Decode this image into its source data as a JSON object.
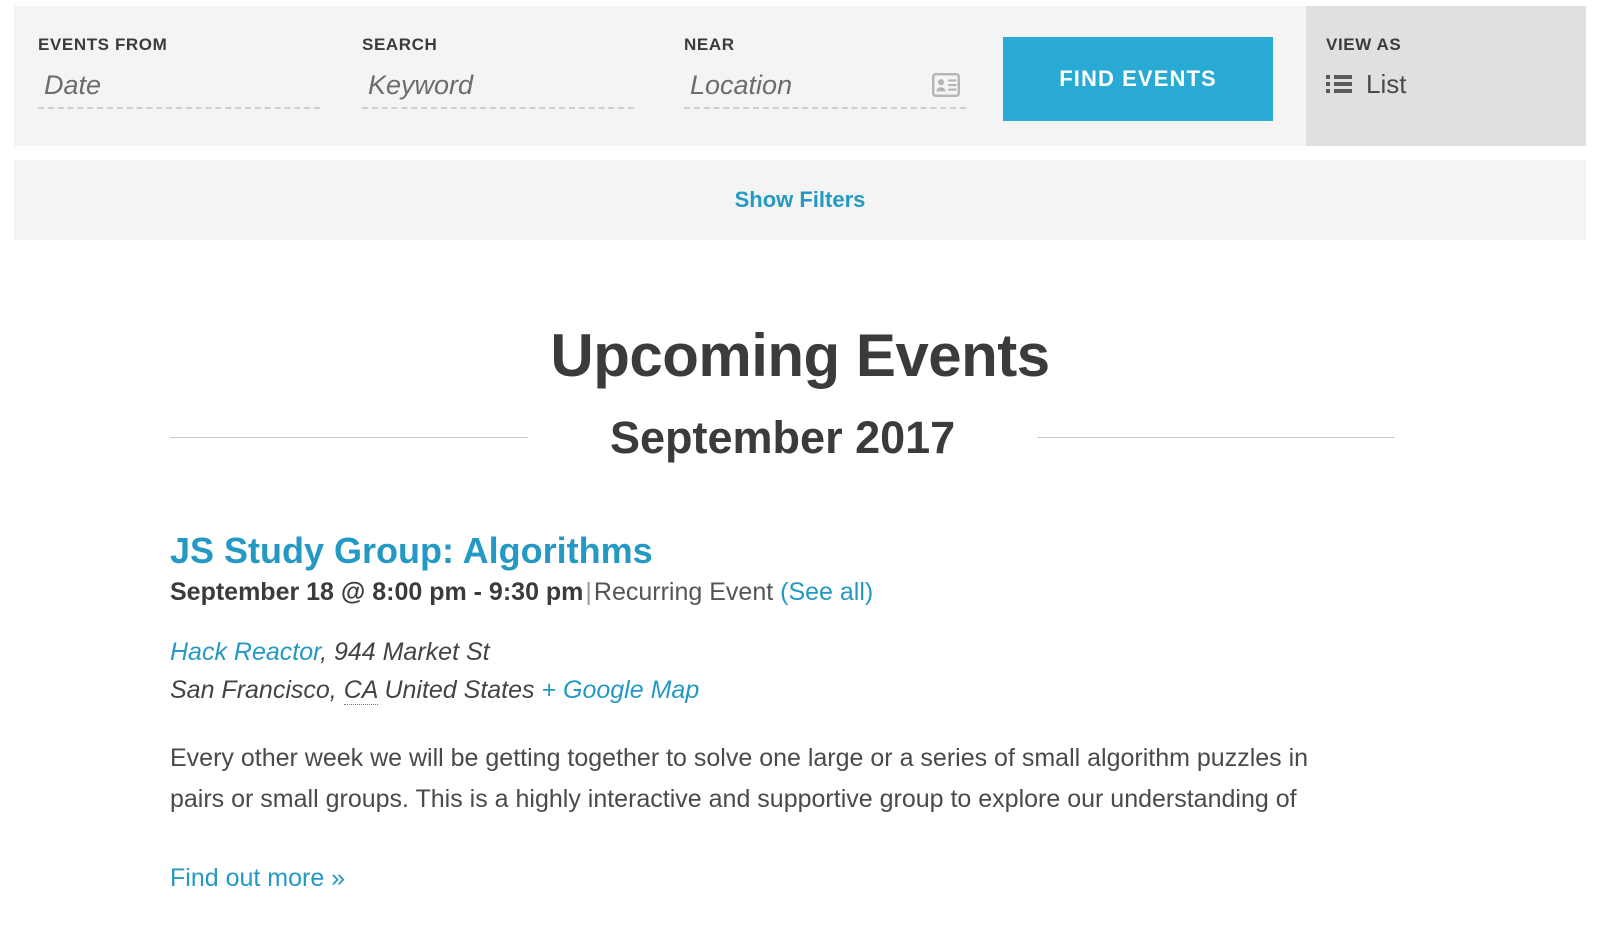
{
  "search_bar": {
    "fields": [
      {
        "label": "EVENTS FROM",
        "placeholder": "Date",
        "value": "",
        "name": "events-from"
      },
      {
        "label": "SEARCH",
        "placeholder": "Keyword",
        "value": "",
        "name": "search-keyword"
      },
      {
        "label": "NEAR",
        "placeholder": "Location",
        "value": "",
        "name": "near-location"
      }
    ],
    "submit_label": "FIND EVENTS",
    "near_icon": "vcard-icon"
  },
  "view_as": {
    "label": "VIEW AS",
    "selected": "List",
    "icon": "list-icon"
  },
  "filters": {
    "toggle_label": "Show Filters"
  },
  "page": {
    "title": "Upcoming Events"
  },
  "month": {
    "title": "September 2017"
  },
  "event": {
    "title": "JS Study Group: Algorithms",
    "date": "September 18 @ 8:00 pm - 9:30 pm",
    "separator": "|",
    "recurring_label": "Recurring Event",
    "see_all_label": "(See all)",
    "venue_name": "Hack Reactor",
    "venue_street": ", 944 Market St",
    "venue_city": "San Francisco, ",
    "venue_state": "CA",
    "venue_country": " United States ",
    "google_map_label": "+ Google Map",
    "description": "Every other week we will be getting together to solve one large or a series of small algorithm puzzles in pairs or small groups. This is a highly interactive and supportive group to explore our understanding of",
    "find_out_more_label": "Find out more »"
  },
  "colors": {
    "accent": "#28aad4",
    "link": "#2499c4",
    "bar_bg": "#f4f4f4",
    "viewas_bg": "#e0e0e0",
    "heading": "#3b3b3b"
  }
}
